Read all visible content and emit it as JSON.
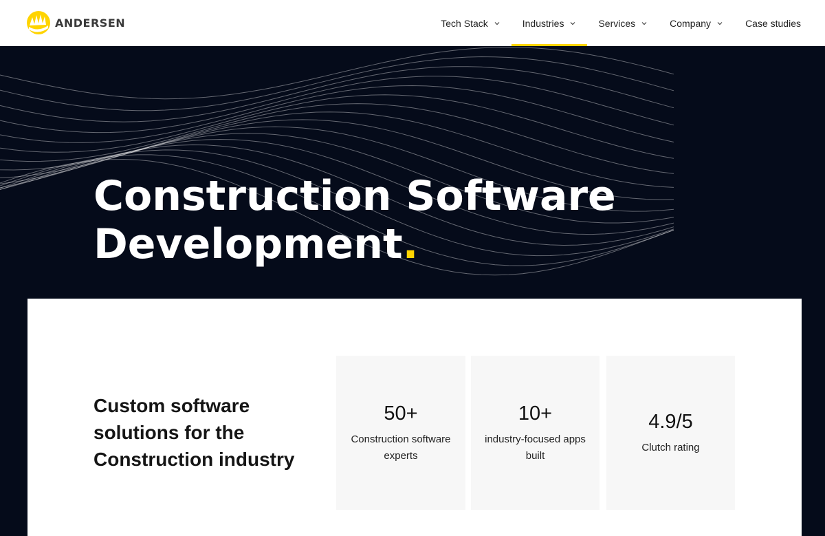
{
  "brand": {
    "name": "ANDERSEN",
    "accent": "#ffd400"
  },
  "nav": {
    "items": [
      {
        "label": "Tech Stack",
        "has_dropdown": true
      },
      {
        "label": "Industries",
        "has_dropdown": true,
        "active": true
      },
      {
        "label": "Services",
        "has_dropdown": true
      },
      {
        "label": "Company",
        "has_dropdown": true
      },
      {
        "label": "Case studies",
        "has_dropdown": false
      }
    ]
  },
  "hero": {
    "title_line1": "Construction Software",
    "title_line2": "Development",
    "title_dot": "."
  },
  "intro": {
    "heading": "Custom software solutions for the Construction industry",
    "stats": [
      {
        "value": "50+",
        "label": "Construction software experts"
      },
      {
        "value": "10+",
        "label": "industry-focused apps built"
      },
      {
        "value": "4.9/5",
        "label": "Clutch rating"
      }
    ]
  },
  "colors": {
    "hero_background": "#050b1a",
    "stat_background": "#f7f7f7"
  }
}
